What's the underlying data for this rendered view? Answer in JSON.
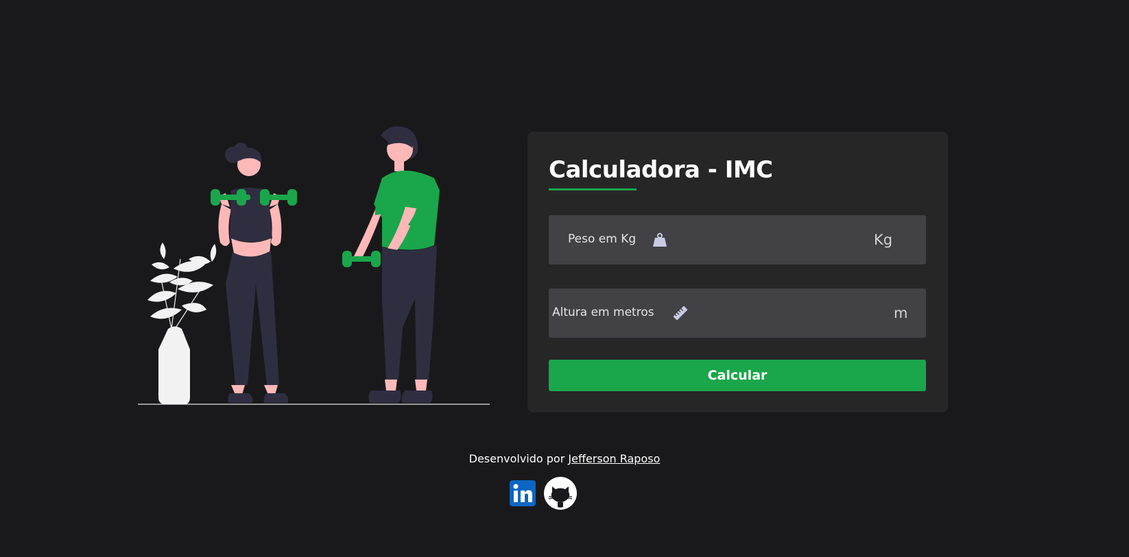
{
  "form": {
    "title": "Calculadora - IMC",
    "weight_label": "Peso em Kg",
    "weight_unit": "Kg",
    "weight_value": "",
    "height_label": "Altura em metros",
    "height_unit": "m",
    "height_value": "",
    "submit_label": "Calcular"
  },
  "footer": {
    "credit_prefix": "Desenvolvido por ",
    "author_name": "Jefferson Raposo"
  },
  "icons": {
    "weight": "weight-icon",
    "height": "ruler-icon",
    "linkedin": "linkedin-icon",
    "github": "github-icon"
  },
  "colors": {
    "background": "#19191b",
    "card": "#262627",
    "field": "#414146",
    "accent": "#1aa64b",
    "linkedin": "#0a66c2"
  }
}
